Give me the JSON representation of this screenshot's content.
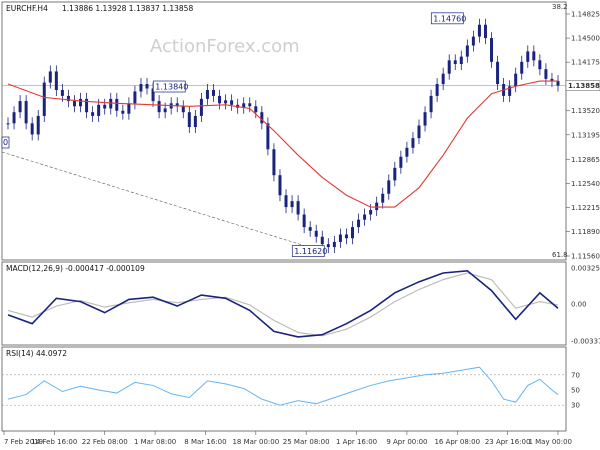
{
  "chart_data": {
    "type": "line",
    "symbol": "EURCHF.H4",
    "ohlc_header": "1.13886 1.13928 1.13837 1.13858",
    "watermark": "ActionForex.com",
    "price_panel": {
      "y_ticks": [
        "1.14825",
        "1.14500",
        "1.14175",
        "1.13850",
        "1.13520",
        "1.13195",
        "1.12865",
        "1.12540",
        "1.12215",
        "1.11890",
        "1.11560"
      ],
      "ylim": [
        1.1156,
        1.14825
      ],
      "last_price": "1.13858",
      "fib_top_label": "38.2",
      "fib_bottom_label": "61.8",
      "annotations": [
        "1.14760",
        "1.13840",
        "1.11620",
        "0"
      ],
      "candles": [
        {
          "x": 0,
          "y": 1.1335
        },
        {
          "x": 1,
          "y": 1.135
        },
        {
          "x": 2,
          "y": 1.1365
        },
        {
          "x": 3,
          "y": 1.1335
        },
        {
          "x": 4,
          "y": 1.132
        },
        {
          "x": 5,
          "y": 1.1345
        },
        {
          "x": 6,
          "y": 1.139
        },
        {
          "x": 7,
          "y": 1.1405
        },
        {
          "x": 8,
          "y": 1.138
        },
        {
          "x": 9,
          "y": 1.1372
        },
        {
          "x": 10,
          "y": 1.1365
        },
        {
          "x": 11,
          "y": 1.1358
        },
        {
          "x": 12,
          "y": 1.1368
        },
        {
          "x": 13,
          "y": 1.135
        },
        {
          "x": 14,
          "y": 1.1345
        },
        {
          "x": 15,
          "y": 1.136
        },
        {
          "x": 16,
          "y": 1.1355
        },
        {
          "x": 17,
          "y": 1.1368
        },
        {
          "x": 18,
          "y": 1.1352
        },
        {
          "x": 19,
          "y": 1.1348
        },
        {
          "x": 20,
          "y": 1.1362
        },
        {
          "x": 21,
          "y": 1.1378
        },
        {
          "x": 22,
          "y": 1.1388
        },
        {
          "x": 23,
          "y": 1.1382
        },
        {
          "x": 24,
          "y": 1.1365
        },
        {
          "x": 25,
          "y": 1.135
        },
        {
          "x": 26,
          "y": 1.1355
        },
        {
          "x": 27,
          "y": 1.1362
        },
        {
          "x": 28,
          "y": 1.1358
        },
        {
          "x": 29,
          "y": 1.135
        },
        {
          "x": 30,
          "y": 1.133
        },
        {
          "x": 31,
          "y": 1.1345
        },
        {
          "x": 32,
          "y": 1.1368
        },
        {
          "x": 33,
          "y": 1.138
        },
        {
          "x": 34,
          "y": 1.1372
        },
        {
          "x": 35,
          "y": 1.1362
        },
        {
          "x": 36,
          "y": 1.1366
        },
        {
          "x": 37,
          "y": 1.136
        },
        {
          "x": 38,
          "y": 1.1356
        },
        {
          "x": 39,
          "y": 1.1362
        },
        {
          "x": 40,
          "y": 1.1358
        },
        {
          "x": 41,
          "y": 1.135
        },
        {
          "x": 42,
          "y": 1.1335
        },
        {
          "x": 43,
          "y": 1.13
        },
        {
          "x": 44,
          "y": 1.1265
        },
        {
          "x": 45,
          "y": 1.1238
        },
        {
          "x": 46,
          "y": 1.1222
        },
        {
          "x": 47,
          "y": 1.123
        },
        {
          "x": 48,
          "y": 1.1212
        },
        {
          "x": 49,
          "y": 1.1195
        },
        {
          "x": 50,
          "y": 1.119
        },
        {
          "x": 51,
          "y": 1.1182
        },
        {
          "x": 52,
          "y": 1.1172
        },
        {
          "x": 53,
          "y": 1.1168
        },
        {
          "x": 54,
          "y": 1.1175
        },
        {
          "x": 55,
          "y": 1.1185
        },
        {
          "x": 56,
          "y": 1.118
        },
        {
          "x": 57,
          "y": 1.1195
        },
        {
          "x": 58,
          "y": 1.1205
        },
        {
          "x": 59,
          "y": 1.1212
        },
        {
          "x": 60,
          "y": 1.1218
        },
        {
          "x": 61,
          "y": 1.1228
        },
        {
          "x": 62,
          "y": 1.124
        },
        {
          "x": 63,
          "y": 1.1258
        },
        {
          "x": 64,
          "y": 1.1275
        },
        {
          "x": 65,
          "y": 1.129
        },
        {
          "x": 66,
          "y": 1.1302
        },
        {
          "x": 67,
          "y": 1.1315
        },
        {
          "x": 68,
          "y": 1.1332
        },
        {
          "x": 69,
          "y": 1.135
        },
        {
          "x": 70,
          "y": 1.1372
        },
        {
          "x": 71,
          "y": 1.1388
        },
        {
          "x": 72,
          "y": 1.1402
        },
        {
          "x": 73,
          "y": 1.142
        },
        {
          "x": 74,
          "y": 1.1415
        },
        {
          "x": 75,
          "y": 1.1425
        },
        {
          "x": 76,
          "y": 1.144
        },
        {
          "x": 77,
          "y": 1.1452
        },
        {
          "x": 78,
          "y": 1.1468
        },
        {
          "x": 79,
          "y": 1.145
        },
        {
          "x": 80,
          "y": 1.1418
        },
        {
          "x": 81,
          "y": 1.1388
        },
        {
          "x": 82,
          "y": 1.1372
        },
        {
          "x": 83,
          "y": 1.1385
        },
        {
          "x": 84,
          "y": 1.1402
        },
        {
          "x": 85,
          "y": 1.1418
        },
        {
          "x": 86,
          "y": 1.1432
        },
        {
          "x": 87,
          "y": 1.142
        },
        {
          "x": 88,
          "y": 1.1408
        },
        {
          "x": 89,
          "y": 1.1395
        },
        {
          "x": 90,
          "y": 1.1392
        },
        {
          "x": 91,
          "y": 1.1386
        }
      ],
      "ma_line": [
        {
          "x": 0,
          "y": 1.1388
        },
        {
          "x": 6,
          "y": 1.137
        },
        {
          "x": 12,
          "y": 1.1365
        },
        {
          "x": 18,
          "y": 1.1362
        },
        {
          "x": 24,
          "y": 1.136
        },
        {
          "x": 30,
          "y": 1.1358
        },
        {
          "x": 36,
          "y": 1.136
        },
        {
          "x": 40,
          "y": 1.1355
        },
        {
          "x": 44,
          "y": 1.1325
        },
        {
          "x": 48,
          "y": 1.1292
        },
        {
          "x": 52,
          "y": 1.1262
        },
        {
          "x": 56,
          "y": 1.1238
        },
        {
          "x": 60,
          "y": 1.1222
        },
        {
          "x": 64,
          "y": 1.1222
        },
        {
          "x": 68,
          "y": 1.1248
        },
        {
          "x": 72,
          "y": 1.1292
        },
        {
          "x": 76,
          "y": 1.1342
        },
        {
          "x": 80,
          "y": 1.1375
        },
        {
          "x": 84,
          "y": 1.1385
        },
        {
          "x": 88,
          "y": 1.1392
        },
        {
          "x": 91,
          "y": 1.1392
        }
      ]
    },
    "macd_panel": {
      "label": "MACD(12,26,9) -0.000417 -0.000109",
      "y_ticks": [
        "0.003254",
        "0.00",
        "-0.003373"
      ],
      "ylim": [
        -0.003373,
        0.003254
      ],
      "macd": [
        {
          "x": 0,
          "y": -0.001
        },
        {
          "x": 4,
          "y": -0.0018
        },
        {
          "x": 8,
          "y": 0.0005
        },
        {
          "x": 12,
          "y": 0.0002
        },
        {
          "x": 16,
          "y": -0.0008
        },
        {
          "x": 20,
          "y": 0.0004
        },
        {
          "x": 24,
          "y": 0.0006
        },
        {
          "x": 28,
          "y": -0.0002
        },
        {
          "x": 32,
          "y": 0.0008
        },
        {
          "x": 36,
          "y": 0.0005
        },
        {
          "x": 40,
          "y": -0.0006
        },
        {
          "x": 44,
          "y": -0.0025
        },
        {
          "x": 48,
          "y": -0.003
        },
        {
          "x": 52,
          "y": -0.0028
        },
        {
          "x": 56,
          "y": -0.0018
        },
        {
          "x": 60,
          "y": -0.0006
        },
        {
          "x": 64,
          "y": 0.001
        },
        {
          "x": 68,
          "y": 0.002
        },
        {
          "x": 72,
          "y": 0.0028
        },
        {
          "x": 76,
          "y": 0.003
        },
        {
          "x": 80,
          "y": 0.0012
        },
        {
          "x": 84,
          "y": -0.0014
        },
        {
          "x": 88,
          "y": 0.001
        },
        {
          "x": 91,
          "y": -0.0004
        }
      ],
      "signal": [
        {
          "x": 0,
          "y": -0.0006
        },
        {
          "x": 4,
          "y": -0.0012
        },
        {
          "x": 8,
          "y": -0.0002
        },
        {
          "x": 12,
          "y": 0.0003
        },
        {
          "x": 16,
          "y": -0.0003
        },
        {
          "x": 20,
          "y": 0.0001
        },
        {
          "x": 24,
          "y": 0.0004
        },
        {
          "x": 28,
          "y": 0.0001
        },
        {
          "x": 32,
          "y": 0.0004
        },
        {
          "x": 36,
          "y": 0.0006
        },
        {
          "x": 40,
          "y": -0.0001
        },
        {
          "x": 44,
          "y": -0.0015
        },
        {
          "x": 48,
          "y": -0.0026
        },
        {
          "x": 52,
          "y": -0.0029
        },
        {
          "x": 56,
          "y": -0.0023
        },
        {
          "x": 60,
          "y": -0.0012
        },
        {
          "x": 64,
          "y": 0.0002
        },
        {
          "x": 68,
          "y": 0.0013
        },
        {
          "x": 72,
          "y": 0.0022
        },
        {
          "x": 76,
          "y": 0.0028
        },
        {
          "x": 80,
          "y": 0.0022
        },
        {
          "x": 84,
          "y": -0.0004
        },
        {
          "x": 88,
          "y": 0.0002
        },
        {
          "x": 91,
          "y": -0.0001
        }
      ]
    },
    "rsi_panel": {
      "label": "RSI(14) 44.0972",
      "y_ticks": [
        "70",
        "50",
        "30"
      ],
      "ylim": [
        0,
        100
      ],
      "values": [
        {
          "x": 0,
          "y": 38
        },
        {
          "x": 3,
          "y": 44
        },
        {
          "x": 6,
          "y": 62
        },
        {
          "x": 9,
          "y": 48
        },
        {
          "x": 12,
          "y": 55
        },
        {
          "x": 15,
          "y": 50
        },
        {
          "x": 18,
          "y": 46
        },
        {
          "x": 21,
          "y": 60
        },
        {
          "x": 24,
          "y": 56
        },
        {
          "x": 27,
          "y": 45
        },
        {
          "x": 30,
          "y": 40
        },
        {
          "x": 33,
          "y": 62
        },
        {
          "x": 36,
          "y": 58
        },
        {
          "x": 39,
          "y": 52
        },
        {
          "x": 42,
          "y": 38
        },
        {
          "x": 45,
          "y": 30
        },
        {
          "x": 48,
          "y": 36
        },
        {
          "x": 51,
          "y": 32
        },
        {
          "x": 54,
          "y": 40
        },
        {
          "x": 57,
          "y": 48
        },
        {
          "x": 60,
          "y": 56
        },
        {
          "x": 63,
          "y": 62
        },
        {
          "x": 66,
          "y": 66
        },
        {
          "x": 69,
          "y": 70
        },
        {
          "x": 72,
          "y": 72
        },
        {
          "x": 75,
          "y": 76
        },
        {
          "x": 78,
          "y": 80
        },
        {
          "x": 80,
          "y": 62
        },
        {
          "x": 82,
          "y": 38
        },
        {
          "x": 84,
          "y": 34
        },
        {
          "x": 86,
          "y": 56
        },
        {
          "x": 88,
          "y": 64
        },
        {
          "x": 90,
          "y": 50
        },
        {
          "x": 91,
          "y": 44
        }
      ]
    },
    "x_ticks": [
      "7 Feb 2019",
      "14 Feb 16:00",
      "22 Feb 08:00",
      "1 Mar 08:00",
      "8 Mar 16:00",
      "18 Mar 00:00",
      "25 Mar 08:00",
      "1 Apr 16:00",
      "9 Apr 00:00",
      "16 Apr 08:00",
      "23 Apr 16:00",
      "1 May 00:00"
    ],
    "colors": {
      "candle": "#1a237e",
      "ma": "#e53935",
      "macd": "#1a237e",
      "signal": "#bdbdbd",
      "rsi": "#64b5f6",
      "grid": "#9e9e9e",
      "text": "#333333"
    }
  }
}
